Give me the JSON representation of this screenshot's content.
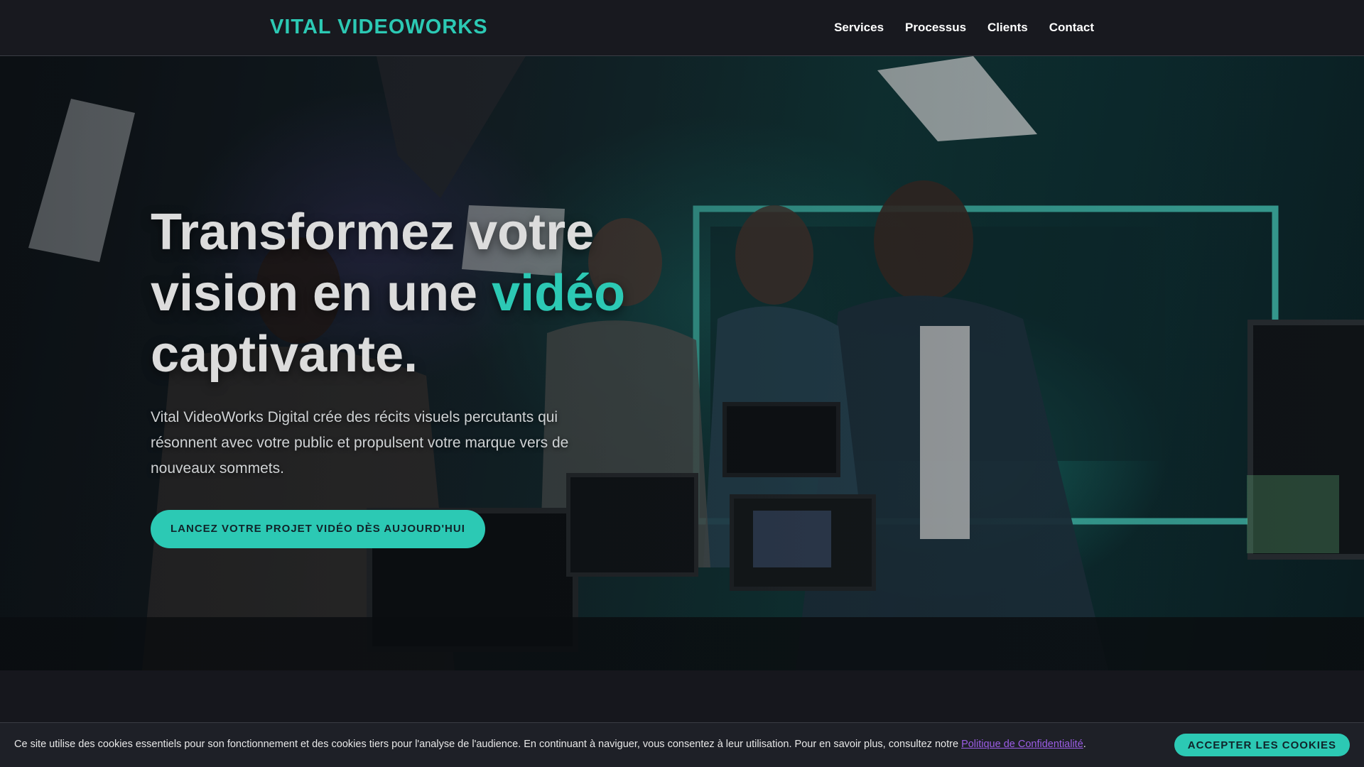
{
  "header": {
    "logo": "VITAL VIDEOWORKS",
    "nav": [
      {
        "label": "Services"
      },
      {
        "label": "Processus"
      },
      {
        "label": "Clients"
      },
      {
        "label": "Contact"
      }
    ]
  },
  "hero": {
    "title_part1": "Transformez votre vision en une ",
    "title_accent": "vidéo",
    "title_part2": " captivante.",
    "subtitle": "Vital VideoWorks Digital crée des récits visuels percutants qui résonnent avec votre public et propulsent votre marque vers de nouveaux sommets.",
    "cta_label": "LANCEZ VOTRE PROJET VIDÉO DÈS AUJOURD'HUI"
  },
  "cookie": {
    "text": "Ce site utilise des cookies essentiels pour son fonctionnement et des cookies tiers pour l'analyse de l'audience. En continuant à naviguer, vous consentez à leur utilisation. Pour en savoir plus, consultez notre ",
    "link_label": "Politique de Confidentialité",
    "text_end": ".",
    "accept_label": "ACCEPTER LES COOKIES"
  },
  "colors": {
    "accent": "#2cc9b4",
    "background": "#16171d",
    "link": "#9b5de5"
  }
}
